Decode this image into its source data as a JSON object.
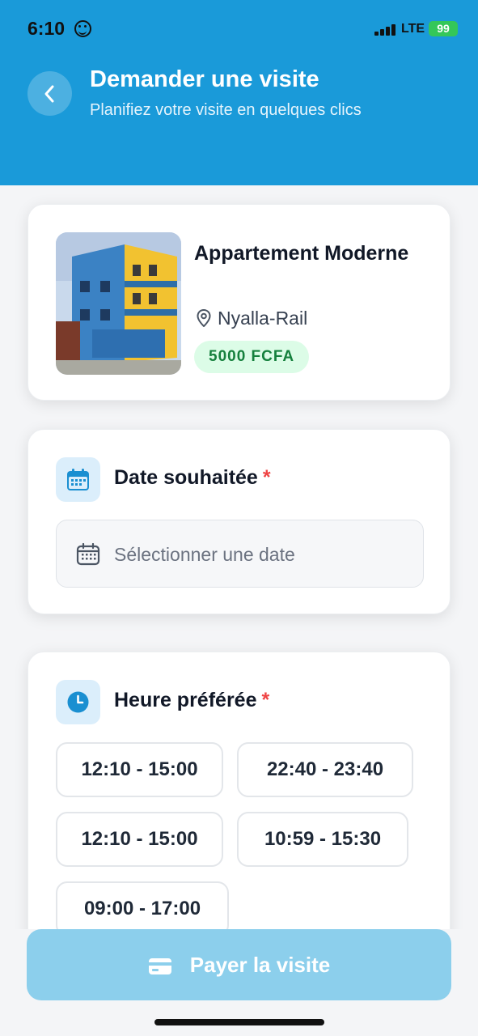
{
  "status_bar": {
    "time": "6:10",
    "network": "LTE",
    "battery": "99"
  },
  "header": {
    "title": "Demander une visite",
    "subtitle": "Planifiez votre visite en quelques clics"
  },
  "property": {
    "name": "Appartement Moderne",
    "location": "Nyalla-Rail",
    "price": "5000 FCFA"
  },
  "date_section": {
    "label": "Date souhaitée",
    "required_mark": "*",
    "placeholder": "Sélectionner une date"
  },
  "time_section": {
    "label": "Heure préférée",
    "required_mark": "*",
    "slots": [
      "12:10 - 15:00",
      "22:40 - 23:40",
      "12:10 - 15:00",
      "10:59 - 15:30",
      "09:00 - 17:00"
    ]
  },
  "pay_button": {
    "label": "Payer la visite"
  },
  "colors": {
    "header": "#1a9ad9",
    "pay_button": "#8ccfec",
    "price_bg": "#dcfce7",
    "price_text": "#15803d",
    "required": "#ef4444"
  }
}
